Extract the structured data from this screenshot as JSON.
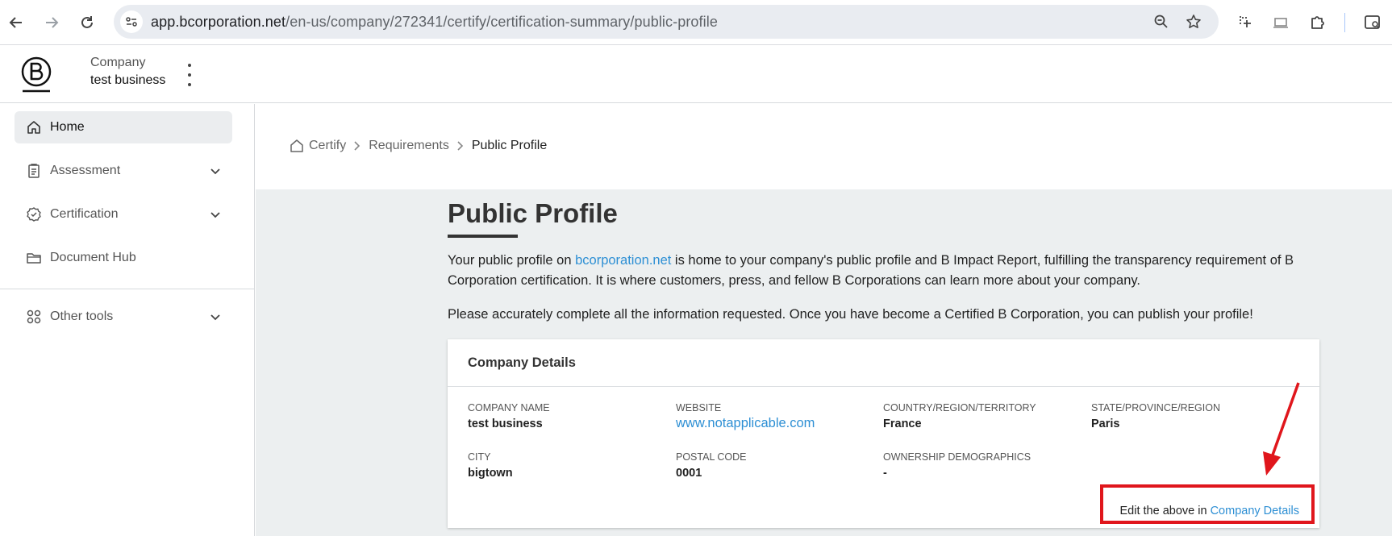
{
  "browser": {
    "url_host": "app.bcorporation.net",
    "url_path": "/en-us/company/272341/certify/certification-summary/public-profile",
    "icons": [
      "back-icon",
      "forward-icon",
      "reload-icon",
      "site-info-icon",
      "zoom-icon",
      "star-icon",
      "screenshot-icon",
      "cast-icon",
      "extensions-icon",
      "sidepanel-icon"
    ]
  },
  "header": {
    "company_label": "Company",
    "company_name": "test business"
  },
  "sidebar": {
    "items": [
      {
        "label": "Home",
        "icon": "home-icon",
        "active": true
      },
      {
        "label": "Assessment",
        "icon": "clipboard-icon",
        "expandable": true
      },
      {
        "label": "Certification",
        "icon": "badge-check-icon",
        "expandable": true
      },
      {
        "label": "Document Hub",
        "icon": "folder-icon"
      },
      {
        "label": "Other tools",
        "icon": "grid-icon",
        "expandable": true
      }
    ]
  },
  "breadcrumb": {
    "items": [
      "Certify",
      "Requirements",
      "Public Profile"
    ]
  },
  "main": {
    "title": "Public Profile",
    "intro_before_link": "Your public profile on ",
    "intro_link": "bcorporation.net",
    "intro_after_link": " is home to your company's public profile and B Impact Report, fulfilling the transparency requirement of B Corporation certification. It is where customers, press, and fellow B Corporations can learn more about your company.",
    "intro_2": "Please accurately complete all the information requested. Once you have become a Certified B Corporation, you can publish your profile!"
  },
  "card": {
    "title": "Company Details",
    "fields": {
      "company_name": {
        "label": "COMPANY NAME",
        "value": "test business"
      },
      "website": {
        "label": "WEBSITE",
        "value": "www.notapplicable.com"
      },
      "country": {
        "label": "COUNTRY/REGION/TERRITORY",
        "value": "France"
      },
      "state": {
        "label": "STATE/PROVINCE/REGION",
        "value": "Paris"
      },
      "city": {
        "label": "CITY",
        "value": "bigtown"
      },
      "postal_code": {
        "label": "POSTAL CODE",
        "value": "0001"
      },
      "ownership": {
        "label": "OWNERSHIP DEMOGRAPHICS",
        "value": "-"
      }
    },
    "edit_prefix": "Edit the above in ",
    "edit_link": "Company Details"
  },
  "colors": {
    "link": "#2d8fd4",
    "annotation": "#e0161c",
    "content_bg": "#eceff0"
  }
}
